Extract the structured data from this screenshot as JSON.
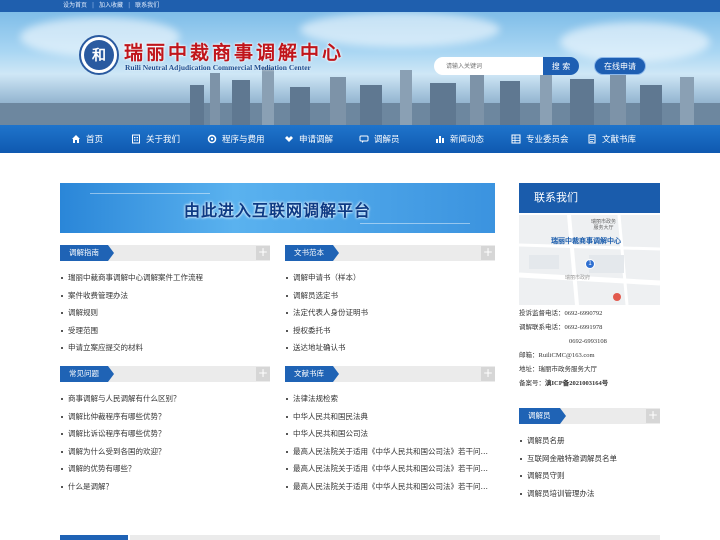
{
  "topbar": {
    "links": [
      "设为首页",
      "加入收藏",
      "联系我们"
    ]
  },
  "header": {
    "logo_char": "和",
    "title": "瑞丽中裁商事调解中心",
    "subtitle": "Ruili Neutral Adjudication Commercial Mediation Center",
    "search_placeholder": "请输入关键词",
    "search_label": "搜 索",
    "apply_label": "在线申请"
  },
  "nav": {
    "items": [
      {
        "label": "首页",
        "icon": "home-icon"
      },
      {
        "label": "关于我们",
        "icon": "building-icon"
      },
      {
        "label": "程序与费用",
        "icon": "gear-icon"
      },
      {
        "label": "申请调解",
        "icon": "handshake-icon"
      },
      {
        "label": "调解员",
        "icon": "chat-icon"
      },
      {
        "label": "新闻动态",
        "icon": "bar-chart-icon"
      },
      {
        "label": "专业委员会",
        "icon": "grid-icon"
      },
      {
        "label": "文献书库",
        "icon": "document-icon"
      }
    ]
  },
  "portal": {
    "label": "由此进入互联网调解平台"
  },
  "sections": {
    "guide": {
      "title": "调解指南",
      "items": [
        "瑞丽中裁商事调解中心调解案件工作流程",
        "案件收费管理办法",
        "调解规则",
        "受理范围",
        "申请立案应提交的材料"
      ]
    },
    "templates": {
      "title": "文书范本",
      "items": [
        "调解申请书（样本）",
        "调解员选定书",
        "法定代表人身份证明书",
        "授权委托书",
        "送达地址确认书"
      ]
    },
    "faq": {
      "title": "常见问题",
      "items": [
        "商事调解与人民调解有什么区别？",
        "调解比仲裁程序有哪些优势？",
        "调解比诉讼程序有哪些优势？",
        "调解为什么受到各国的欢迎？",
        "调解的优势有哪些？",
        "什么是调解？"
      ]
    },
    "library": {
      "title": "文献书库",
      "items": [
        "法律法规检索",
        "中华人民共和国民法典",
        "中华人民共和国公司法",
        "最高人民法院关于适用《中华人民共和国公司法》若干问题的规定",
        "最高人民法院关于适用《中华人民共和国公司法》若干问题的规定",
        "最高人民法院关于适用《中华人民共和国公司法》若干问题的规定"
      ]
    },
    "mediators": {
      "title": "调解员",
      "items": [
        "调解员名册",
        "互联网金融特邀调解员名单",
        "调解员守则",
        "调解员培训管理办法"
      ]
    }
  },
  "contact": {
    "title": "联系我们",
    "map_title": "瑞丽中裁商事调解中心",
    "map_building": "瑞丽市政务\n服务大厅",
    "map_street": "瑞丽市政府",
    "pin_label": "1",
    "lines": {
      "complaint": "投诉监督电话：0692-6990792",
      "mediation": "调解联系电话：0692-6991978",
      "mediation2": "0692-6993108",
      "email": "邮箱：RuiliCMC@163.com",
      "address": "地址：瑞丽市政务服务大厅",
      "icp_label": "备案号：",
      "icp": "滇ICP备2021003164号"
    }
  },
  "colors": {
    "brand_blue": "#1f63b5",
    "title_red": "#c0151b"
  }
}
